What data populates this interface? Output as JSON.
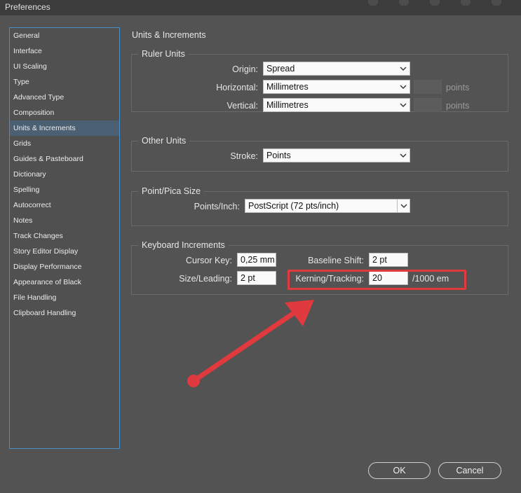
{
  "window": {
    "title": "Preferences"
  },
  "sidebar": {
    "items": [
      {
        "label": "General"
      },
      {
        "label": "Interface"
      },
      {
        "label": "UI Scaling"
      },
      {
        "label": "Type"
      },
      {
        "label": "Advanced Type"
      },
      {
        "label": "Composition"
      },
      {
        "label": "Units & Increments",
        "selected": true
      },
      {
        "label": "Grids"
      },
      {
        "label": "Guides & Pasteboard"
      },
      {
        "label": "Dictionary"
      },
      {
        "label": "Spelling"
      },
      {
        "label": "Autocorrect"
      },
      {
        "label": "Notes"
      },
      {
        "label": "Track Changes"
      },
      {
        "label": "Story Editor Display"
      },
      {
        "label": "Display Performance"
      },
      {
        "label": "Appearance of Black"
      },
      {
        "label": "File Handling"
      },
      {
        "label": "Clipboard Handling"
      }
    ]
  },
  "main": {
    "title": "Units & Increments",
    "ruler_units": {
      "title": "Ruler Units",
      "origin_label": "Origin:",
      "origin_value": "Spread",
      "horizontal_label": "Horizontal:",
      "horizontal_value": "Millimetres",
      "vertical_label": "Vertical:",
      "vertical_value": "Millimetres",
      "points_suffix": "points"
    },
    "other_units": {
      "title": "Other Units",
      "stroke_label": "Stroke:",
      "stroke_value": "Points"
    },
    "point_pica": {
      "title": "Point/Pica Size",
      "points_inch_label": "Points/Inch:",
      "points_inch_value": "PostScript (72 pts/inch)"
    },
    "keyboard": {
      "title": "Keyboard Increments",
      "cursor_key_label": "Cursor Key:",
      "cursor_key_value": "0,25 mm",
      "baseline_label": "Baseline Shift:",
      "baseline_value": "2 pt",
      "size_leading_label": "Size/Leading:",
      "size_leading_value": "2 pt",
      "kerning_label": "Kerning/Tracking:",
      "kerning_value": "20",
      "kerning_unit": "/1000 em"
    }
  },
  "buttons": {
    "ok": "OK",
    "cancel": "Cancel"
  },
  "colors": {
    "highlight": "#e0393e",
    "selected": "#4b6072",
    "sidebar_border": "#4a90c8"
  }
}
